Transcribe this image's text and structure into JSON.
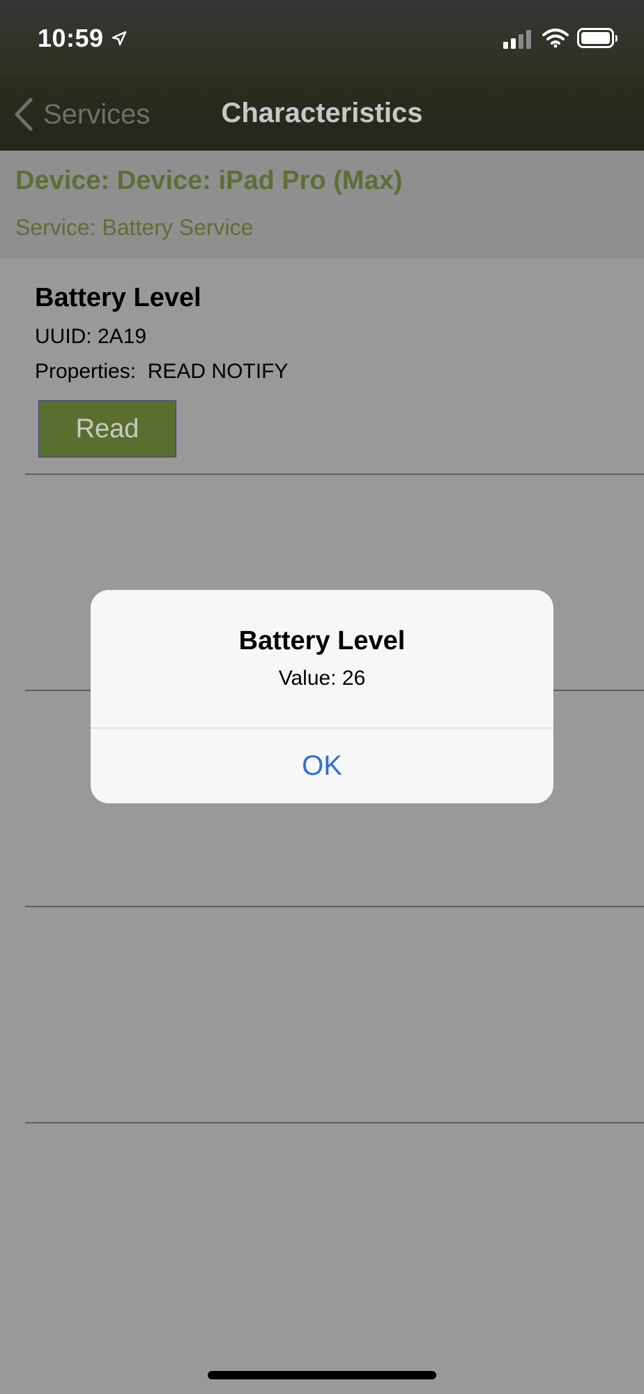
{
  "status_bar": {
    "time": "10:59",
    "icons": [
      "location-arrow-icon",
      "cellular-signal-icon",
      "wifi-icon",
      "battery-icon"
    ]
  },
  "nav": {
    "back_label": "Services",
    "title": "Characteristics"
  },
  "header": {
    "device": "Device: Device: iPad Pro (Max)",
    "service": "Service: Battery Service"
  },
  "characteristic": {
    "name": "Battery Level",
    "uuid": "UUID: 2A19",
    "properties": "Properties:  READ NOTIFY",
    "read_button": "Read"
  },
  "alert": {
    "title": "Battery Level",
    "message": "Value: 26",
    "ok_button": "OK"
  },
  "colors": {
    "accent_green": "#5a6f2f",
    "header_text_green": "#5d6e35",
    "alert_button_blue": "#2f6fd8",
    "dimmed_background": "#999999"
  }
}
